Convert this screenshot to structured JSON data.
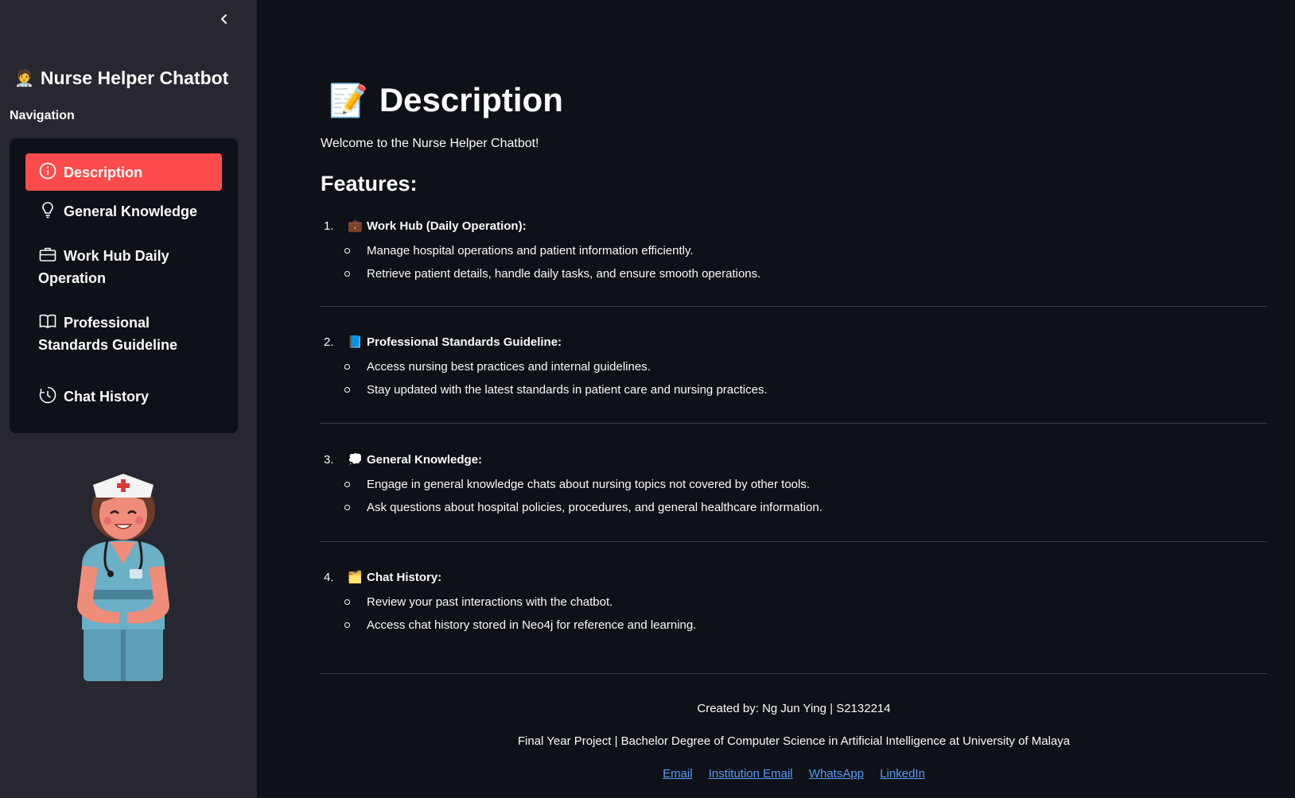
{
  "sidebar": {
    "collapse_icon": "chevron-left-icon",
    "app_title": "Nurse Helper Chatbot",
    "app_title_emoji": "🧑‍⚕️",
    "nav_heading": "Navigation",
    "nav_items": [
      {
        "label": "Description",
        "icon": "info-circle-icon",
        "active": true
      },
      {
        "label": "General Knowledge",
        "icon": "lightbulb-icon",
        "active": false
      },
      {
        "label": "Work Hub Daily Operation",
        "icon": "briefcase-icon",
        "active": false
      },
      {
        "label": "Professional Standards Guideline",
        "icon": "book-icon",
        "active": false
      },
      {
        "label": "Chat History",
        "icon": "clock-history-icon",
        "active": false
      }
    ],
    "illustration": "nurse-illustration"
  },
  "main": {
    "title_emoji": "📝",
    "title": "Description",
    "welcome": "Welcome to the Nurse Helper Chatbot!",
    "features_heading": "Features:",
    "features": [
      {
        "number": "1.",
        "emoji": "💼",
        "title": "Work Hub (Daily Operation):",
        "bullets": [
          "Manage hospital operations and patient information efficiently.",
          "Retrieve patient details, handle daily tasks, and ensure smooth operations."
        ]
      },
      {
        "number": "2.",
        "emoji": "📘",
        "title": "Professional Standards Guideline:",
        "bullets": [
          "Access nursing best practices and internal guidelines.",
          "Stay updated with the latest standards in patient care and nursing practices."
        ]
      },
      {
        "number": "3.",
        "emoji": "💭",
        "title": "General Knowledge:",
        "bullets": [
          "Engage in general knowledge chats about nursing topics not covered by other tools.",
          "Ask questions about hospital policies, procedures, and general healthcare information."
        ]
      },
      {
        "number": "4.",
        "emoji": "🗂️",
        "title": "Chat History:",
        "bullets": [
          "Review your past interactions with the chatbot.",
          "Access chat history stored in Neo4j for reference and learning."
        ]
      }
    ],
    "footer": {
      "created_by": "Created by: Ng Jun Ying | S2132214",
      "project": "Final Year Project | Bachelor Degree of Computer Science in Artificial Intelligence at University of Malaya",
      "links": [
        "Email",
        "Institution Email",
        "WhatsApp",
        "LinkedIn"
      ]
    }
  },
  "colors": {
    "sidebar_bg": "#262730",
    "main_bg": "#0e1117",
    "active_accent": "#ff4b4b",
    "link": "#5b9cf5"
  }
}
